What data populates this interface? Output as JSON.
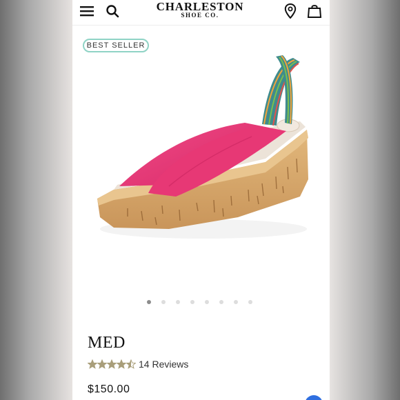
{
  "header": {
    "logo_line1": "CHARLESTON",
    "logo_line2": "SHOE CO.",
    "icons": [
      "menu-icon",
      "search-icon",
      "location-pin-icon",
      "shopping-bag-icon"
    ]
  },
  "product": {
    "badge": "BEST SELLER",
    "title": "MED",
    "rating": 4.5,
    "rating_max": 5,
    "reviews": "14 Reviews",
    "price": "$150.00",
    "image_count": 8,
    "active_image": 1
  },
  "colors": {
    "badge_border": "#8fd3c5",
    "star": "#a99e7a",
    "chat": "#2f6fe0",
    "upper": "#e73875",
    "cork": "#d6a86b"
  }
}
